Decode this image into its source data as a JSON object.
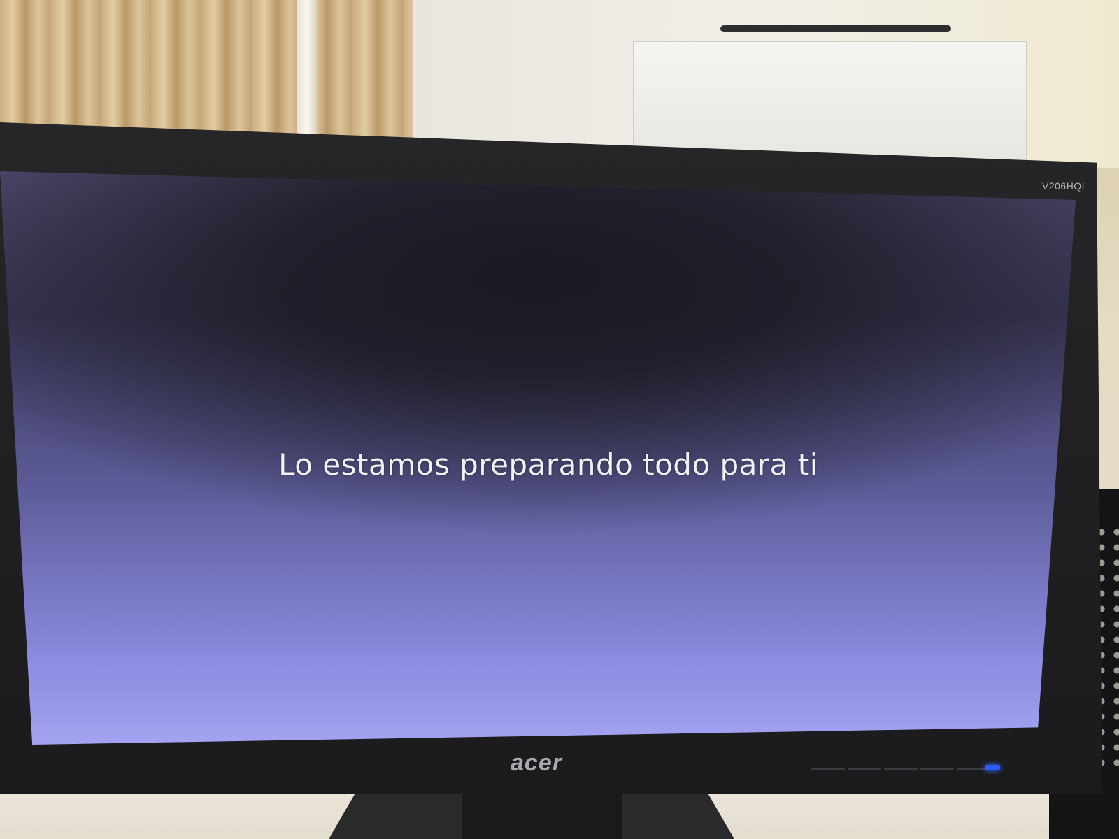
{
  "screen": {
    "message": "Lo estamos preparando todo para ti"
  },
  "monitor": {
    "model": "V206HQL",
    "brand": "acer",
    "power_led_color": "#2a5cff"
  },
  "colors": {
    "screen_top": "#3a3858",
    "screen_bottom": "#a4a4f2",
    "text": "#f2f2f6"
  }
}
